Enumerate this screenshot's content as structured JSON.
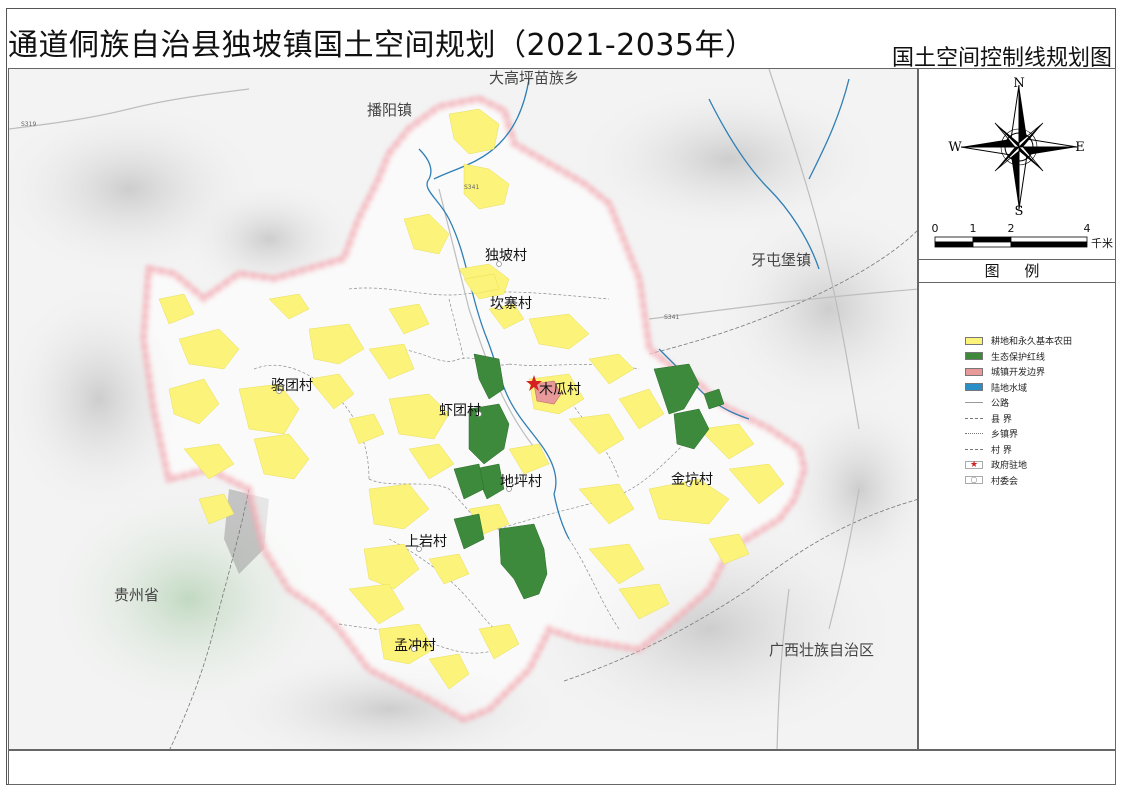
{
  "header": {
    "main_title": "通道侗族自治县独坡镇国土空间规划（2021-2035年）",
    "sub_title": "国土空间控制线规划图"
  },
  "compass": {
    "n": "N",
    "s": "S",
    "e": "E",
    "w": "W"
  },
  "scale_bar": {
    "ticks": [
      "0",
      "1",
      "2",
      "4"
    ],
    "unit": "千米"
  },
  "legend": {
    "title": "图  例",
    "items": [
      {
        "label": "耕地和永久基本农田",
        "color": "#fbf37a"
      },
      {
        "label": "生态保护红线",
        "color": "#3d8a3d"
      },
      {
        "label": "城镇开发边界",
        "color": "#e89a9a"
      },
      {
        "label": "陆地水域",
        "color": "#2b8ec6"
      },
      {
        "label": "公路",
        "color": "#999999"
      },
      {
        "label": "县  界",
        "color": "#777777"
      },
      {
        "label": "乡镇界",
        "color": "#777777"
      },
      {
        "label": "村  界",
        "color": "#777777"
      },
      {
        "label": "政府驻地",
        "color": "#d42020"
      },
      {
        "label": "村委会",
        "color": "#999999"
      }
    ]
  },
  "places": {
    "outside": {
      "north_township": "大高坪苗族乡",
      "northwest_town": "播阳镇",
      "east_town": "牙屯堡镇",
      "guizhou": "贵州省",
      "guangxi": "广西壮族自治区"
    },
    "villages": {
      "dupo": "独坡村",
      "kanzhai": "坎寨村",
      "mugua": "木瓜村",
      "xiatuan": "虾团村",
      "luotuan": "骆团村",
      "dipingcun": "地坪村",
      "jinkeng": "金坑村",
      "shangyan": "上岩村",
      "mengchong": "孟冲村"
    }
  },
  "roads": {
    "s341_a": "S341",
    "s341_b": "S341",
    "s319": "S319"
  }
}
